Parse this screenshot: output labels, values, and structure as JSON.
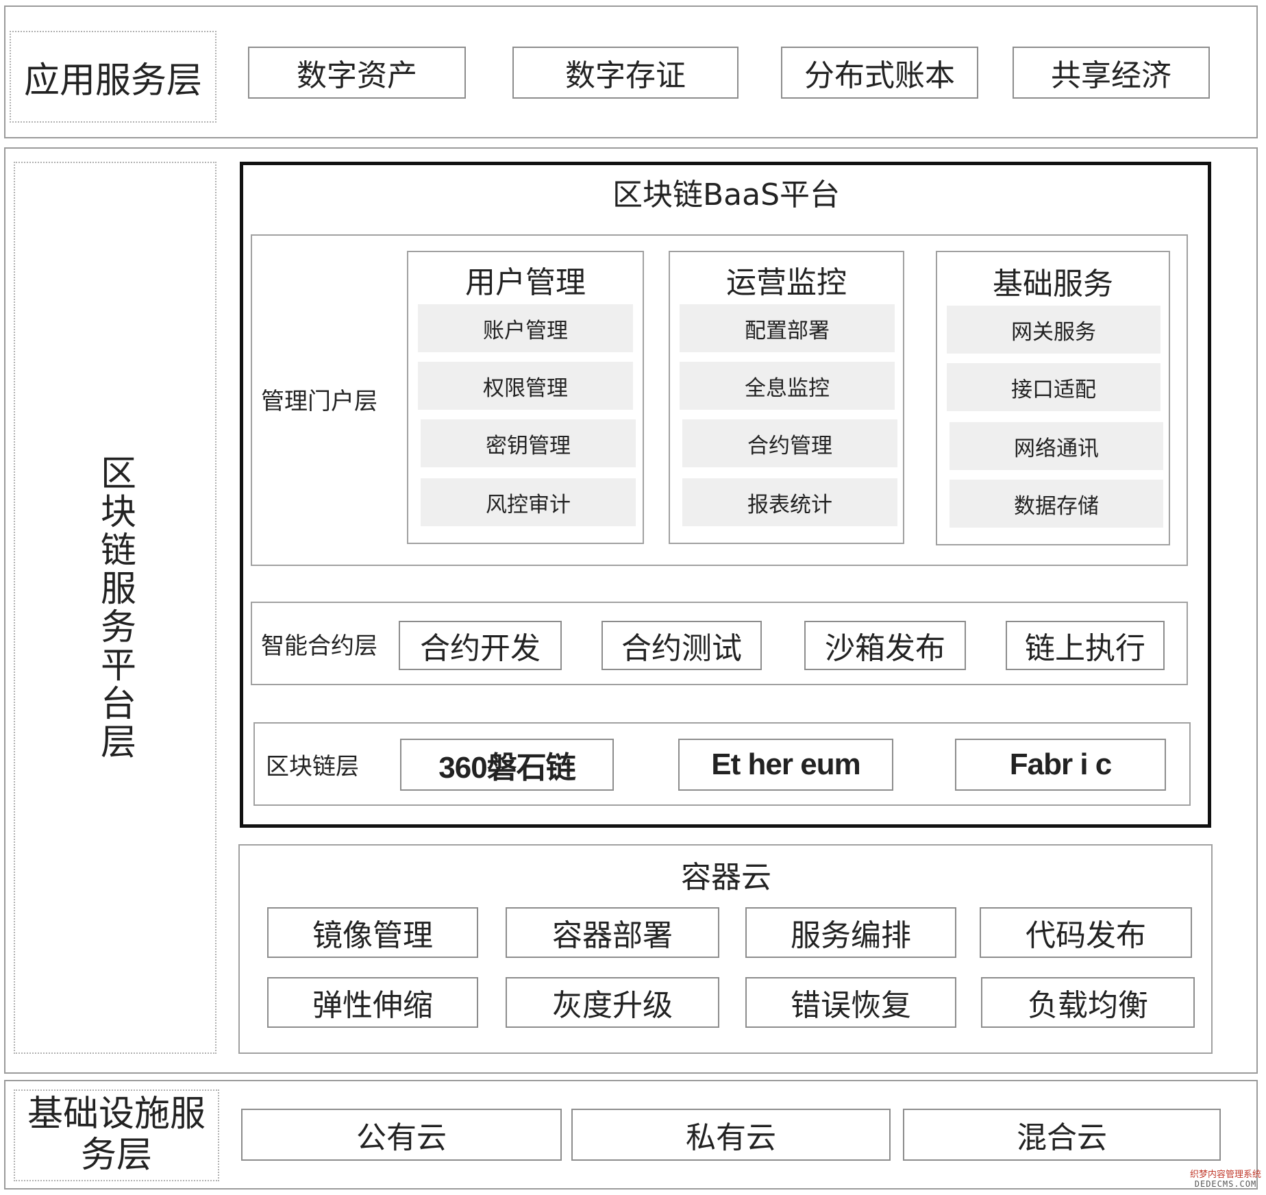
{
  "app_layer": {
    "title": "应用服务层",
    "items": [
      "数字资产",
      "数字存证",
      "分布式账本",
      "共享经济"
    ]
  },
  "platform_layer": {
    "title": "区块链服务平台层",
    "baas": {
      "title": "区块链BaaS平台",
      "portal": {
        "label": "管理门户层",
        "groups": [
          {
            "title": "用户管理",
            "items": [
              "账户管理",
              "权限管理",
              "密钥管理",
              "风控审计"
            ]
          },
          {
            "title": "运营监控",
            "items": [
              "配置部署",
              "全息监控",
              "合约管理",
              "报表统计"
            ]
          },
          {
            "title": "基础服务",
            "items": [
              "网关服务",
              "接口适配",
              "网络通讯",
              "数据存储"
            ]
          }
        ]
      },
      "contract": {
        "label": "智能合约层",
        "items": [
          "合约开发",
          "合约测试",
          "沙箱发布",
          "链上执行"
        ]
      },
      "chain": {
        "label": "区块链层",
        "items": [
          "360磐石链",
          "Et her eum",
          "Fabr i c"
        ]
      }
    },
    "container_cloud": {
      "title": "容器云",
      "items": [
        "镜像管理",
        "容器部署",
        "服务编排",
        "代码发布",
        "弹性伸缩",
        "灰度升级",
        "错误恢复",
        "负载均衡"
      ]
    }
  },
  "infra_layer": {
    "title_line1": "基础设施服",
    "title_line2": "务层",
    "items": [
      "公有云",
      "私有云",
      "混合云"
    ]
  },
  "watermark": {
    "line1": "织梦内容管理系统",
    "line2": "DEDECMS.COM"
  }
}
